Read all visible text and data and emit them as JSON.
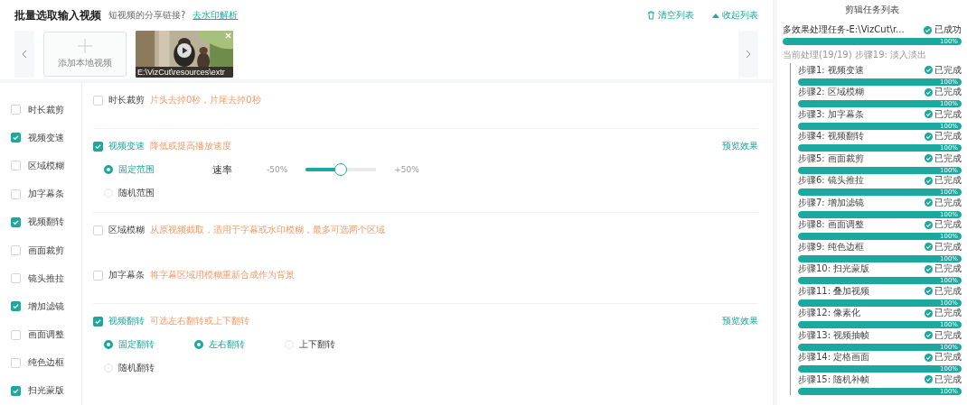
{
  "header": {
    "title": "批量选取输入视频",
    "question": "短视频的分享链接?",
    "link": "去水印解析",
    "actions": [
      {
        "kind": "clear",
        "label": "清空列表"
      },
      {
        "kind": "collapse",
        "label": "收起列表"
      }
    ]
  },
  "videos": {
    "add_label": "添加本地视频",
    "items": [
      {
        "kind": "picture",
        "caption": "E:\\VizCut\\resources\\extr"
      }
    ]
  },
  "effects_menu": [
    {
      "label": "时长裁剪",
      "checked": false
    },
    {
      "label": "视频变速",
      "checked": true
    },
    {
      "label": "区域模糊",
      "checked": false
    },
    {
      "label": "加字幕条",
      "checked": false
    },
    {
      "label": "视频翻转",
      "checked": true
    },
    {
      "label": "画面裁剪",
      "checked": false
    },
    {
      "label": "镜头推拉",
      "checked": false
    },
    {
      "label": "增加滤镜",
      "checked": true
    },
    {
      "label": "画面调整",
      "checked": false
    },
    {
      "label": "纯色边框",
      "checked": false
    },
    {
      "label": "扫光蒙版",
      "checked": true
    }
  ],
  "sections": [
    {
      "kind": "plain",
      "label": "时长裁剪",
      "hint": "片头去掉0秒，片尾去掉0秒",
      "checked": false
    },
    {
      "kind": "speed",
      "label": "视频变速",
      "hint": "降低或提高播放速度",
      "checked": true,
      "preview": "预览效果",
      "mode_options": [
        {
          "label": "固定范围",
          "selected": true
        },
        {
          "label": "随机范围",
          "selected": false
        }
      ],
      "slider": {
        "label": "速率",
        "min": "-50%",
        "max": "+50%",
        "level": 0.5
      }
    },
    {
      "kind": "plain",
      "label": "区域模糊",
      "hint": "从原视频截取，适用于字幕或水印模糊，最多可选两个区域",
      "checked": false
    },
    {
      "kind": "plain",
      "label": "加字幕条",
      "hint": "将字幕区域用模糊重新合成作为背景",
      "checked": false
    },
    {
      "kind": "flip",
      "label": "视频翻转",
      "hint": "可选左右翻转或上下翻转",
      "checked": true,
      "preview": "预览效果",
      "mode_options": [
        {
          "label": "固定翻转",
          "selected": true
        },
        {
          "label": "随机翻转",
          "selected": false
        }
      ],
      "direction_options": [
        {
          "label": "左右翻转",
          "selected": true
        },
        {
          "label": "上下翻转",
          "selected": false
        }
      ]
    }
  ],
  "tasks": {
    "title": "剪辑任务列表",
    "task": {
      "name": "多效果处理任务-E:\\VizCut\\r...",
      "status": "已成功",
      "level": 1,
      "percent": "100%",
      "current": "当前处理(19/19) 步骤19: 淡入淡出",
      "steps": [
        {
          "label": "步骤1: 视频变速",
          "status": "已完成",
          "level": 1,
          "percent": "100%"
        },
        {
          "label": "步骤2: 区域模糊",
          "status": "已完成",
          "level": 1,
          "percent": "100%"
        },
        {
          "label": "步骤3: 加字幕条",
          "status": "已完成",
          "level": 1,
          "percent": "100%"
        },
        {
          "label": "步骤4: 视频翻转",
          "status": "已完成",
          "level": 1,
          "percent": "100%"
        },
        {
          "label": "步骤5: 画面裁剪",
          "status": "已完成",
          "level": 1,
          "percent": "100%"
        },
        {
          "label": "步骤6: 镜头推拉",
          "status": "已完成",
          "level": 1,
          "percent": "100%"
        },
        {
          "label": "步骤7: 增加滤镜",
          "status": "已完成",
          "level": 1,
          "percent": "100%"
        },
        {
          "label": "步骤8: 画面调整",
          "status": "已完成",
          "level": 1,
          "percent": "100%"
        },
        {
          "label": "步骤9: 纯色边框",
          "status": "已完成",
          "level": 1,
          "percent": "100%"
        },
        {
          "label": "步骤10: 扫光蒙版",
          "status": "已完成",
          "level": 1,
          "percent": "100%"
        },
        {
          "label": "步骤11: 叠加视频",
          "status": "已完成",
          "level": 1,
          "percent": "100%"
        },
        {
          "label": "步骤12: 像素化",
          "status": "已完成",
          "level": 1,
          "percent": "100%"
        },
        {
          "label": "步骤13: 视频抽帧",
          "status": "已完成",
          "level": 1,
          "percent": "100%"
        },
        {
          "label": "步骤14: 定格画面",
          "status": "已完成",
          "level": 1,
          "percent": "100%"
        },
        {
          "label": "步骤15: 随机补帧",
          "status": "已完成",
          "level": 1,
          "percent": "100%"
        }
      ]
    }
  }
}
